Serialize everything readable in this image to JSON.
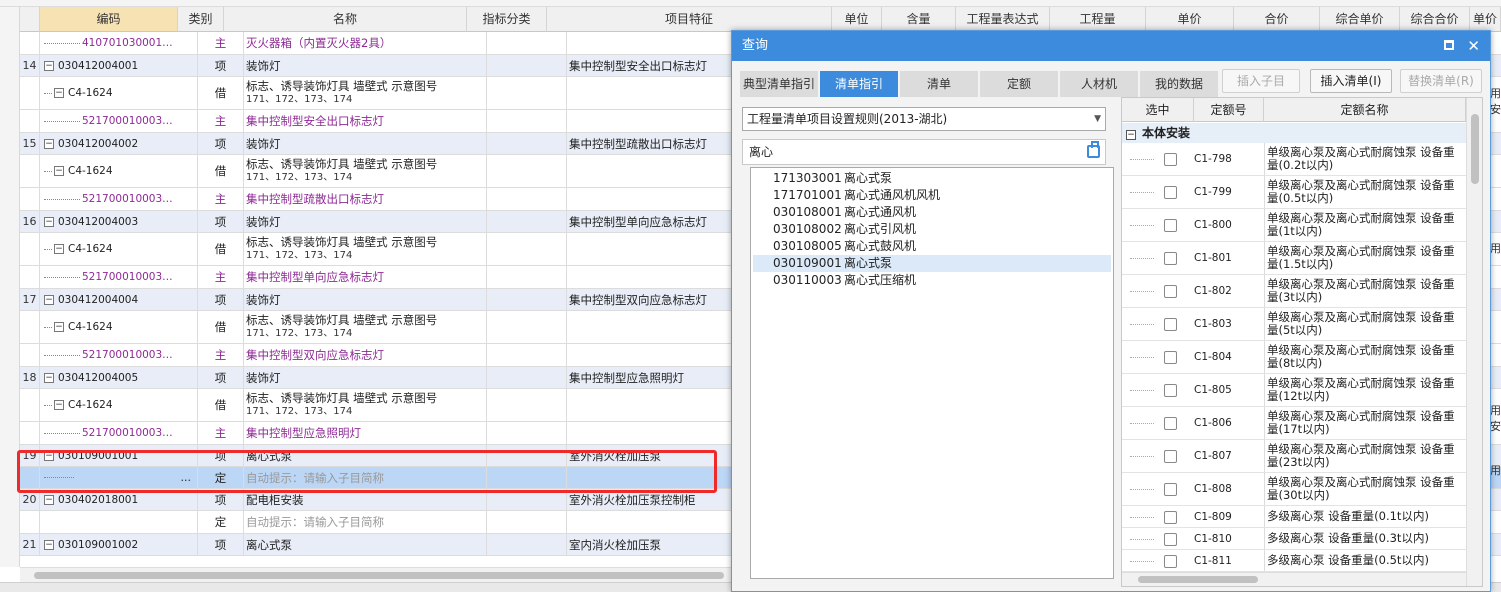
{
  "grid": {
    "headers": {
      "code": "编码",
      "type": "类别",
      "name": "名称",
      "indicator": "指标分类",
      "feature": "项目特征",
      "unit": "单位",
      "qty": "含量",
      "expr": "工程量表达式",
      "amount": "工程量",
      "price": "单价",
      "total": "合价",
      "comp_price": "综合单价",
      "comp_total": "综合合价",
      "extra": "单价"
    },
    "rows": [
      {
        "num": "",
        "code": "410701030001…",
        "type": "主",
        "name": "灭火器箱（内置灭火器2具）",
        "feature": "",
        "kind": "main"
      },
      {
        "num": "14",
        "code": "030412004001",
        "type": "项",
        "name": "装饰灯",
        "feature": "集中控制型安全出口标志灯",
        "kind": "item"
      },
      {
        "num": "",
        "code": "C4-1624",
        "type": "借",
        "name": "标志、诱导装饰灯具  墙壁式  示意图号",
        "name2": "171、172、173、174",
        "feature": "",
        "kind": "quota"
      },
      {
        "num": "",
        "code": "521700010003…",
        "type": "主",
        "name": "集中控制型安全出口标志灯",
        "feature": "",
        "kind": "main"
      },
      {
        "num": "15",
        "code": "030412004002",
        "type": "项",
        "name": "装饰灯",
        "feature": "集中控制型疏散出口标志灯",
        "kind": "item"
      },
      {
        "num": "",
        "code": "C4-1624",
        "type": "借",
        "name": "标志、诱导装饰灯具  墙壁式  示意图号",
        "name2": "171、172、173、174",
        "feature": "",
        "kind": "quota"
      },
      {
        "num": "",
        "code": "521700010003…",
        "type": "主",
        "name": "集中控制型疏散出口标志灯",
        "feature": "",
        "kind": "main"
      },
      {
        "num": "16",
        "code": "030412004003",
        "type": "项",
        "name": "装饰灯",
        "feature": "集中控制型单向应急标志灯",
        "kind": "item"
      },
      {
        "num": "",
        "code": "C4-1624",
        "type": "借",
        "name": "标志、诱导装饰灯具  墙壁式  示意图号",
        "name2": "171、172、173、174",
        "feature": "",
        "kind": "quota"
      },
      {
        "num": "",
        "code": "521700010003…",
        "type": "主",
        "name": "集中控制型单向应急标志灯",
        "feature": "",
        "kind": "main"
      },
      {
        "num": "17",
        "code": "030412004004",
        "type": "项",
        "name": "装饰灯",
        "feature": "集中控制型双向应急标志灯",
        "kind": "item"
      },
      {
        "num": "",
        "code": "C4-1624",
        "type": "借",
        "name": "标志、诱导装饰灯具  墙壁式  示意图号",
        "name2": "171、172、173、174",
        "feature": "",
        "kind": "quota"
      },
      {
        "num": "",
        "code": "521700010003…",
        "type": "主",
        "name": "集中控制型双向应急标志灯",
        "feature": "",
        "kind": "main"
      },
      {
        "num": "18",
        "code": "030412004005",
        "type": "项",
        "name": "装饰灯",
        "feature": "集中控制型应急照明灯",
        "kind": "item"
      },
      {
        "num": "",
        "code": "C4-1624",
        "type": "借",
        "name": "标志、诱导装饰灯具  墙壁式  示意图号",
        "name2": "171、172、173、174",
        "feature": "",
        "kind": "quota"
      },
      {
        "num": "",
        "code": "521700010003…",
        "type": "主",
        "name": "集中控制型应急照明灯",
        "feature": "",
        "kind": "main"
      },
      {
        "num": "19",
        "code": "030109001001",
        "type": "项",
        "name": "离心式泵",
        "feature": "室外消火栓加压泵",
        "kind": "item"
      },
      {
        "num": "",
        "code": "…",
        "type": "定",
        "name": "自动提示：请输入子目简称",
        "feature": "",
        "kind": "sel"
      },
      {
        "num": "20",
        "code": "030402018001",
        "type": "项",
        "name": "配电柜安装",
        "feature": "室外消火栓加压泵控制柜",
        "kind": "item"
      },
      {
        "num": "",
        "code": "",
        "type": "定",
        "name": "自动提示：请输入子目简称",
        "feature": "",
        "kind": "hint"
      },
      {
        "num": "21",
        "code": "030109001002",
        "type": "项",
        "name": "离心式泵",
        "feature": "室内消火栓加压泵",
        "kind": "item"
      }
    ],
    "right_edge_fragments": [
      "用安",
      "用",
      "用安",
      "用"
    ]
  },
  "dialog": {
    "title": "查询",
    "tabs": [
      "典型清单指引",
      "清单指引",
      "清单",
      "定额",
      "人材机",
      "我的数据"
    ],
    "active_tab": 1,
    "buttons": {
      "insert_sub": "插入子目",
      "insert_list": "插入清单(I)",
      "replace_list": "替换清单(R)"
    },
    "rule_select": "工程量清单项目设置规则(2013-湖北)",
    "search_value": "离心",
    "results": [
      {
        "code": "171303001",
        "name": "离心式泵"
      },
      {
        "code": "171701001",
        "name": "离心式通风机风机"
      },
      {
        "code": "030108001",
        "name": "离心式通风机"
      },
      {
        "code": "030108002",
        "name": "离心式引风机"
      },
      {
        "code": "030108005",
        "name": "离心式鼓风机"
      },
      {
        "code": "030109001",
        "name": "离心式泵"
      },
      {
        "code": "030110003",
        "name": "离心式压缩机"
      }
    ],
    "selected_result": 5,
    "quota_headers": {
      "select": "选中",
      "code": "定额号",
      "name": "定额名称"
    },
    "group": "本体安装",
    "quotas": [
      {
        "code": "C1-798",
        "name": "单级离心泵及离心式耐腐蚀泵  设备重量(0.2t以内)"
      },
      {
        "code": "C1-799",
        "name": "单级离心泵及离心式耐腐蚀泵  设备重量(0.5t以内)"
      },
      {
        "code": "C1-800",
        "name": "单级离心泵及离心式耐腐蚀泵  设备重量(1t以内)"
      },
      {
        "code": "C1-801",
        "name": "单级离心泵及离心式耐腐蚀泵  设备重量(1.5t以内)"
      },
      {
        "code": "C1-802",
        "name": "单级离心泵及离心式耐腐蚀泵  设备重量(3t以内)"
      },
      {
        "code": "C1-803",
        "name": "单级离心泵及离心式耐腐蚀泵  设备重量(5t以内)"
      },
      {
        "code": "C1-804",
        "name": "单级离心泵及离心式耐腐蚀泵  设备重量(8t以内)"
      },
      {
        "code": "C1-805",
        "name": "单级离心泵及离心式耐腐蚀泵  设备重量(12t以内)"
      },
      {
        "code": "C1-806",
        "name": "单级离心泵及离心式耐腐蚀泵  设备重量(17t以内)"
      },
      {
        "code": "C1-807",
        "name": "单级离心泵及离心式耐腐蚀泵  设备重量(23t以内)"
      },
      {
        "code": "C1-808",
        "name": "单级离心泵及离心式耐腐蚀泵  设备重量(30t以内)"
      },
      {
        "code": "C1-809",
        "name": "多级离心泵  设备重量(0.1t以内)"
      },
      {
        "code": "C1-810",
        "name": "多级离心泵  设备重量(0.3t以内)"
      },
      {
        "code": "C1-811",
        "name": "多级离心泵  设备重量(0.5t以内)"
      }
    ]
  },
  "colors": {
    "accent": "#3c8bdd",
    "highlight_box": "#ee2a2a",
    "main_material_text": "#8e2a95",
    "item_row": "#e8edf7",
    "selected_row": "#bcd6f6"
  }
}
